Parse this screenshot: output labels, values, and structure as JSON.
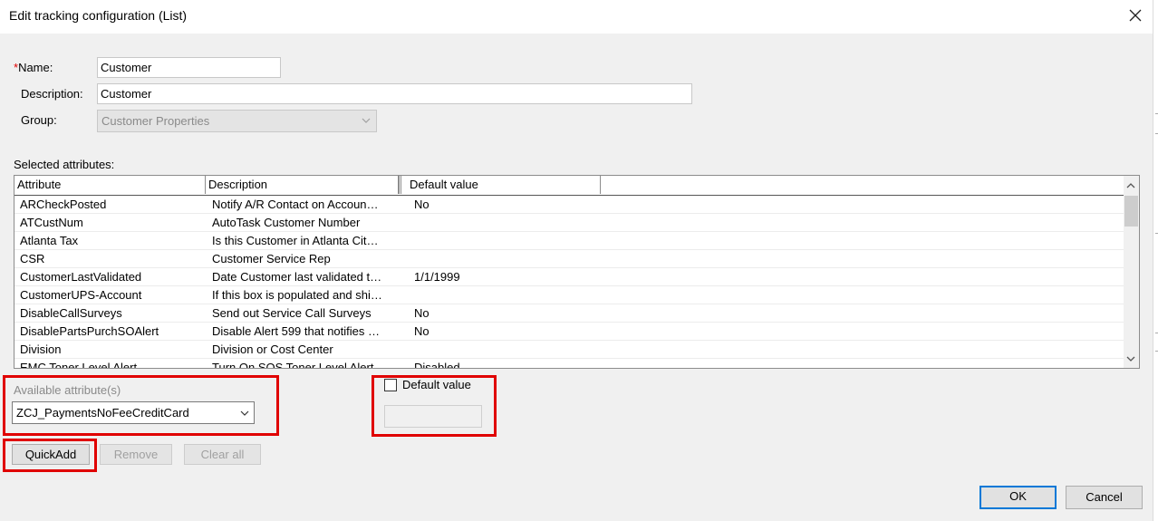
{
  "window": {
    "title": "Edit tracking configuration (List)"
  },
  "form": {
    "name_required_mark": "*",
    "name_label": "Name:",
    "name_value": "Customer",
    "description_label": "Description:",
    "description_value": "Customer",
    "group_label": "Group:",
    "group_value": "Customer Properties"
  },
  "selected_attributes": {
    "label": "Selected attributes:",
    "columns": [
      "Attribute",
      "Description",
      "Default value"
    ],
    "rows": [
      {
        "attribute": "ARCheckPosted",
        "description": "Notify A/R Contact on Accoun…",
        "default": "No"
      },
      {
        "attribute": "ATCustNum",
        "description": "AutoTask Customer Number",
        "default": ""
      },
      {
        "attribute": "Atlanta Tax",
        "description": "Is this Customer in Atlanta Cit…",
        "default": ""
      },
      {
        "attribute": "CSR",
        "description": "Customer Service Rep",
        "default": ""
      },
      {
        "attribute": "CustomerLastValidated",
        "description": "Date Customer last validated t…",
        "default": "1/1/1999"
      },
      {
        "attribute": "CustomerUPS-Account",
        "description": "If this box is populated and shi…",
        "default": ""
      },
      {
        "attribute": "DisableCallSurveys",
        "description": "Send out Service Call Surveys",
        "default": "No"
      },
      {
        "attribute": "DisablePartsPurchSOAlert",
        "description": "Disable Alert 599 that notifies …",
        "default": "No"
      },
      {
        "attribute": "Division",
        "description": "Division or Cost Center",
        "default": ""
      },
      {
        "attribute": "EMC Toner Level Alert",
        "description": "Turn On SOS Toner Level Alert",
        "default": "Disabled"
      }
    ]
  },
  "available": {
    "label": "Available attribute(s)",
    "selected": "ZCJ_PaymentsNoFeeCreditCard"
  },
  "default_value": {
    "checkbox_label": "Default value",
    "checked": false,
    "value": ""
  },
  "buttons": {
    "quickadd": "QuickAdd",
    "remove": "Remove",
    "clear_all": "Clear all",
    "ok": "OK",
    "cancel": "Cancel"
  },
  "colors": {
    "highlight_border": "#e00000",
    "default_button_border": "#0078d7",
    "dialog_background": "#f0f0f0"
  },
  "icons": {
    "close": "close-icon",
    "dropdown": "chevron-down-icon",
    "scroll_up": "scroll-up-icon",
    "scroll_down": "scroll-down-icon"
  }
}
